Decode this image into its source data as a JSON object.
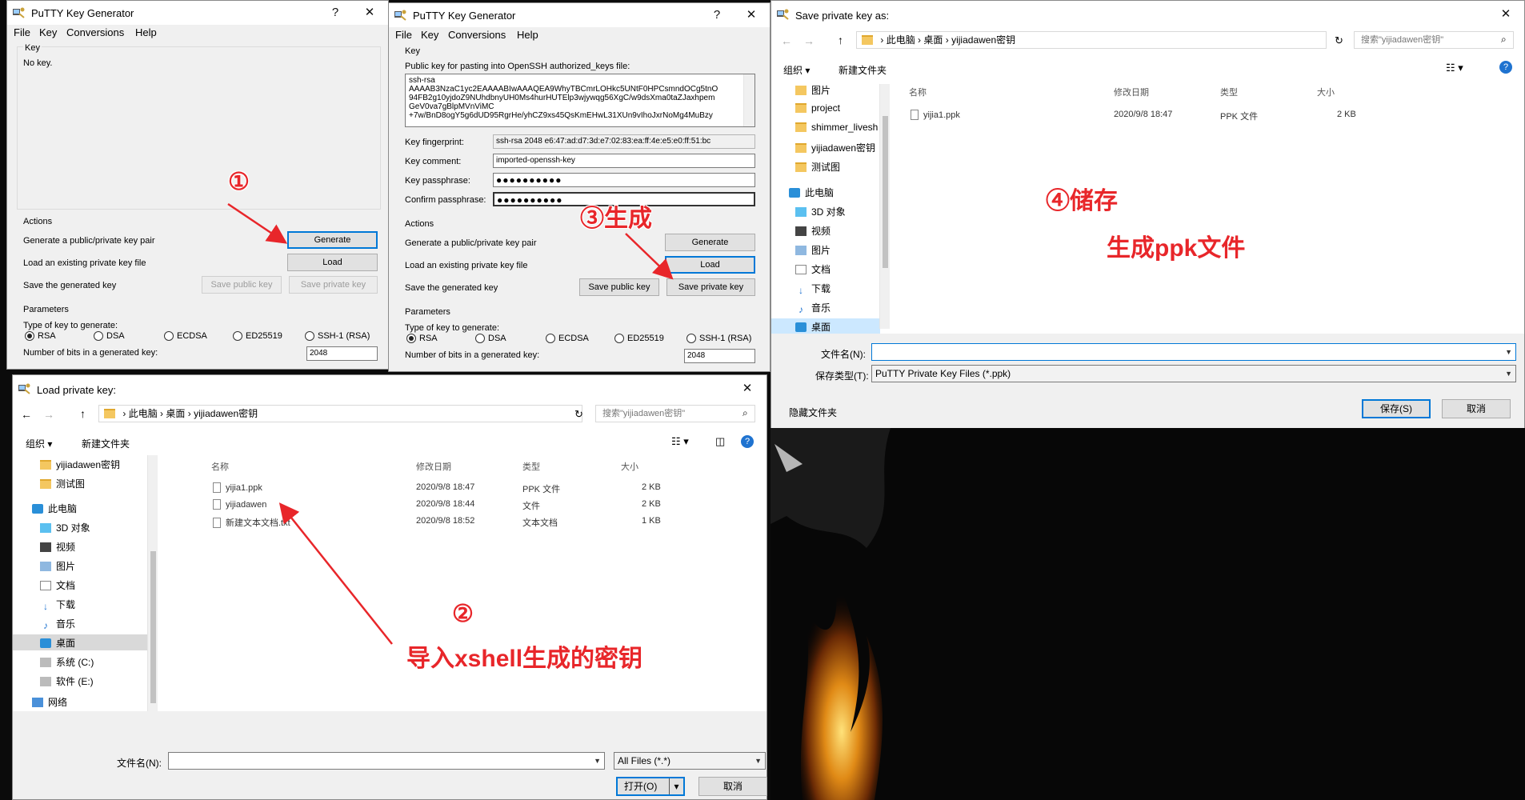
{
  "gen1": {
    "title": "PuTTY Key Generator",
    "help": "?",
    "close": "✕",
    "menus": [
      "File",
      "Key",
      "Conversions",
      "Help"
    ],
    "key_group": "Key",
    "no_key": "No key.",
    "actions": "Actions",
    "row_generate": "Generate a public/private key pair",
    "row_load": "Load an existing private key file",
    "row_save": "Save the generated key",
    "btn_generate": "Generate",
    "btn_load": "Load",
    "btn_save_public": "Save public key",
    "btn_save_private": "Save private key",
    "params": "Parameters",
    "type_label": "Type of key to generate:",
    "types": [
      "RSA",
      "DSA",
      "ECDSA",
      "ED25519",
      "SSH-1 (RSA)"
    ],
    "bits_label": "Number of bits in a generated key:",
    "bits": "2048"
  },
  "gen2": {
    "title": "PuTTY Key Generator",
    "help": "?",
    "close": "✕",
    "menus": [
      "File",
      "Key",
      "Conversions",
      "Help"
    ],
    "key_group": "Key",
    "pub_label": "Public key for pasting into OpenSSH authorized_keys file:",
    "pub_lines": [
      "ssh-rsa",
      "AAAAB3NzaC1yc2EAAAABIwAAAQEA9WhyTBCmrLOHkc5UNtF0HPCsmndOCg5tnO",
      "94FB2g10yjdoZ9NUhdbnyUH0Ms4hurHUTElp3wjywqg56XgC/w9dsXma0taZJaxhpem",
      "GeV0va7gBlpMVnViMC",
      "+7w/BnD8ogY5g6dUD95RgrHe/yhCZ9xs45QsKmEHwL31XUn9vIhoJxrNoMg4MuBzy"
    ],
    "fp_label": "Key fingerprint:",
    "fp": "ssh-rsa 2048 e6:47:ad:d7:3d:e7:02:83:ea:ff:4e:e5:e0:ff:51:bc",
    "comment_label": "Key comment:",
    "comment": "imported-openssh-key",
    "pass_label": "Key passphrase:",
    "pass": "●●●●●●●●●●",
    "confirm_label": "Confirm passphrase:",
    "confirm": "●●●●●●●●●●",
    "actions": "Actions",
    "row_generate": "Generate a public/private key pair",
    "row_load": "Load an existing private key file",
    "row_save": "Save the generated key",
    "btn_generate": "Generate",
    "btn_load": "Load",
    "btn_save_public": "Save public key",
    "btn_save_private": "Save private key",
    "params": "Parameters",
    "type_label": "Type of key to generate:",
    "types": [
      "RSA",
      "DSA",
      "ECDSA",
      "ED25519",
      "SSH-1 (RSA)"
    ],
    "bits_label": "Number of bits in a generated key:",
    "bits": "2048"
  },
  "load": {
    "title": "Load private key:",
    "close": "✕",
    "crumbs": [
      "此电脑",
      "桌面",
      "yijiadawen密钥"
    ],
    "search": "搜索\"yijiadawen密钥\"",
    "organize": "组织 ▾",
    "new_folder": "新建文件夹",
    "nav": [
      "yijiadawen密钥",
      "测试图",
      "此电脑",
      "3D 对象",
      "视频",
      "图片",
      "文档",
      "下载",
      "音乐",
      "桌面",
      "系统 (C:)",
      "软件 (E:)",
      "网络"
    ],
    "cols": [
      "名称",
      "修改日期",
      "类型",
      "大小"
    ],
    "files": [
      {
        "name": "yijia1.ppk",
        "date": "2020/9/8 18:47",
        "type": "PPK 文件",
        "size": "2 KB"
      },
      {
        "name": "yijiadawen",
        "date": "2020/9/8 18:44",
        "type": "文件",
        "size": "2 KB"
      },
      {
        "name": "新建文本文档.txt",
        "date": "2020/9/8 18:52",
        "type": "文本文档",
        "size": "1 KB"
      }
    ],
    "filename_label": "文件名(N):",
    "filter": "All Files (*.*)",
    "open": "打开(O)",
    "cancel": "取消"
  },
  "save": {
    "title": "Save private key as:",
    "close": "✕",
    "crumbs": [
      "此电脑",
      "桌面",
      "yijiadawen密钥"
    ],
    "search": "搜索\"yijiadawen密钥\"",
    "organize": "组织 ▾",
    "new_folder": "新建文件夹",
    "nav": [
      "图片",
      "project",
      "shimmer_livesh",
      "yijiadawen密钥",
      "测试图",
      "此电脑",
      "3D 对象",
      "视频",
      "图片",
      "文档",
      "下载",
      "音乐",
      "桌面"
    ],
    "cols": [
      "名称",
      "修改日期",
      "类型",
      "大小"
    ],
    "files": [
      {
        "name": "yijia1.ppk",
        "date": "2020/9/8 18:47",
        "type": "PPK 文件",
        "size": "2 KB"
      }
    ],
    "filename_label": "文件名(N):",
    "filetype_label": "保存类型(T):",
    "filetype": "PuTTY Private Key Files (*.ppk)",
    "hide_folders": "隐藏文件夹",
    "save": "保存(S)",
    "cancel": "取消"
  },
  "annotations": {
    "a1": "①",
    "a2": "②",
    "a2_text": "导入xshell生成的密钥",
    "a3": "③生成",
    "a4": "④储存",
    "a4_text": "生成ppk文件"
  },
  "colors": {
    "annotation": "#e8262a",
    "accent": "#0078d7",
    "selection": "#cce8ff"
  }
}
